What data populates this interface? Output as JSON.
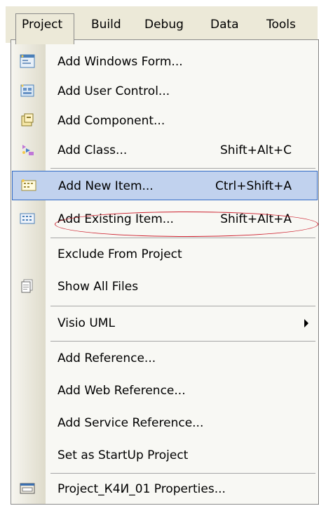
{
  "menubar": {
    "items": [
      "Project",
      "Build",
      "Debug",
      "Data",
      "Tools"
    ]
  },
  "menu": {
    "items": [
      {
        "label": "Add Windows Form...",
        "shortcut": "",
        "icon": "windows-form-icon"
      },
      {
        "label": "Add User Control...",
        "shortcut": "",
        "icon": "user-control-icon"
      },
      {
        "label": "Add Component...",
        "shortcut": "",
        "icon": "component-icon"
      },
      {
        "label": "Add Class...",
        "shortcut": "Shift+Alt+C",
        "icon": "class-icon"
      },
      {
        "label": "Add New Item...",
        "shortcut": "Ctrl+Shift+A",
        "icon": "new-item-icon"
      },
      {
        "label": "Add Existing Item...",
        "shortcut": "Shift+Alt+A",
        "icon": "existing-item-icon"
      },
      {
        "label": "Exclude From Project",
        "shortcut": "",
        "icon": ""
      },
      {
        "label": "Show All Files",
        "shortcut": "",
        "icon": "show-all-files-icon"
      },
      {
        "label": "Visio UML",
        "shortcut": "",
        "icon": ""
      },
      {
        "label": "Add Reference...",
        "shortcut": "",
        "icon": ""
      },
      {
        "label": "Add Web Reference...",
        "shortcut": "",
        "icon": ""
      },
      {
        "label": "Add Service Reference...",
        "shortcut": "",
        "icon": ""
      },
      {
        "label": "Set as StartUp Project",
        "shortcut": "",
        "icon": ""
      },
      {
        "label": "Project_К4И_01 Properties...",
        "shortcut": "",
        "icon": "properties-icon"
      }
    ]
  },
  "colors": {
    "highlight_fill": "#c1d2ee",
    "highlight_border": "#316ac5",
    "annotation_ellipse": "#cc1f2d"
  }
}
